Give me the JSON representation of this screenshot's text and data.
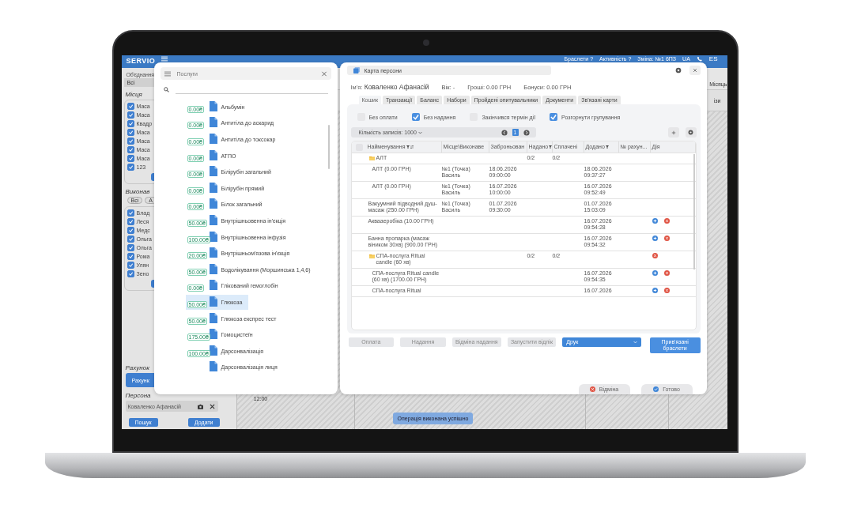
{
  "top_bar": {
    "logo": "SERVIO",
    "items": [
      "Браслети ?",
      "Активність ?",
      "Зміна: №1 6ПЗ",
      "UA"
    ],
    "language": "ES"
  },
  "sidebar": {
    "union_label": "Об'єднання",
    "union_value": "Всі",
    "places_title": "Місця",
    "places": [
      {
        "label": "Маса",
        "checked": true
      },
      {
        "label": "Маса",
        "checked": true
      },
      {
        "label": "Квадр",
        "checked": true
      },
      {
        "label": "Маса",
        "checked": true
      },
      {
        "label": "Маса",
        "checked": true
      },
      {
        "label": "Маса",
        "checked": true
      },
      {
        "label": "Маса",
        "checked": true
      },
      {
        "label": "123",
        "checked": true
      }
    ],
    "executors_title": "Виконав",
    "executor_filters": [
      "Всі",
      "А"
    ],
    "executors": [
      {
        "label": "Влад",
        "checked": true
      },
      {
        "label": "Леся",
        "checked": true
      },
      {
        "label": "Медс",
        "checked": true
      },
      {
        "label": "Ольга",
        "checked": true
      },
      {
        "label": "Ольга",
        "checked": true
      },
      {
        "label": "Рома",
        "checked": true
      },
      {
        "label": "Улян",
        "checked": true
      },
      {
        "label": "Зено",
        "checked": true
      }
    ],
    "account_title": "Рахунок",
    "account_button": "Рахунк",
    "person_title": "Персона",
    "person_value": "Коваленко Афанасій",
    "buttons": [
      "Пошук",
      "Додати"
    ]
  },
  "calendar": {
    "view": "Місяць",
    "column_header": "ізи",
    "time": "12:00"
  },
  "services": {
    "title": "Послуги",
    "items": [
      {
        "name": "Альбумін",
        "price": "0.00₴",
        "selected": false
      },
      {
        "name": "Антитіла до аскарид",
        "price": "0.00₴",
        "selected": false
      },
      {
        "name": "Антитіла до токсокар",
        "price": "0.00₴",
        "selected": false
      },
      {
        "name": "АТПО",
        "price": "0.00₴",
        "selected": false
      },
      {
        "name": "Білірубін загальний",
        "price": "0.00₴",
        "selected": false
      },
      {
        "name": "Білірубін прямий",
        "price": "0.00₴",
        "selected": false
      },
      {
        "name": "Білок загальний",
        "price": "0.00₴",
        "selected": false
      },
      {
        "name": "Внутрішньовенна ін'єкція",
        "price": "50.00₴",
        "selected": false
      },
      {
        "name": "Внутрішньовенна інфузія",
        "price": "100.00₴",
        "selected": false
      },
      {
        "name": "Внутрішньом'язова ін'єкція",
        "price": "20.00₴",
        "selected": false
      },
      {
        "name": "Водолікування (Моршинська 1,4,6)",
        "price": "50.00₴",
        "selected": false
      },
      {
        "name": "Глікований гемоглобін",
        "price": "0.00₴",
        "selected": false
      },
      {
        "name": "Глюкоза",
        "price": "50.00₴",
        "selected": true
      },
      {
        "name": "Глюкоза експрес тест",
        "price": "50.00₴",
        "selected": false
      },
      {
        "name": "Гомоцистеїн",
        "price": "175.00₴",
        "selected": false
      },
      {
        "name": "Дарсонвалізація",
        "price": "100.00₴",
        "selected": false
      },
      {
        "name": "Дарсонвалізація лиця",
        "selected": false
      }
    ]
  },
  "person_card": {
    "title": "Карта персони",
    "name_label": "Ім'я:",
    "name": "Коваленко Афанасій",
    "age": "Вік: -",
    "money": "Гроші: 0.00 ГРН",
    "bonuses": "Бонуси: 0.00 ГРН",
    "tabs": [
      {
        "label": "Кошик",
        "selected": true
      },
      {
        "label": "Транзакції",
        "selected": false
      },
      {
        "label": "Баланс",
        "selected": false
      },
      {
        "label": "Набори",
        "selected": false
      },
      {
        "label": "Пройдені опитувальники",
        "selected": false
      },
      {
        "label": "Документи",
        "selected": false
      },
      {
        "label": "Зв'язані карти",
        "selected": false
      }
    ],
    "filters": [
      {
        "label": "Без оплати",
        "checked": false
      },
      {
        "label": "Без надання",
        "checked": true
      },
      {
        "label": "Закінчився термін дії",
        "checked": false
      },
      {
        "label": "Розгорнути групування",
        "checked": true
      }
    ],
    "records_label": "Кількість записів: 1000",
    "page": "1",
    "select_all_checked": false,
    "columns": [
      {
        "label": "Найменування",
        "filter": true,
        "sort": true
      },
      {
        "label": "Місце\\Виконаве",
        "filter": false,
        "sort": false
      },
      {
        "label": "Заброньован",
        "filter": false,
        "sort": false
      },
      {
        "label": "Надано",
        "filter": true,
        "sort": false
      },
      {
        "label": "Сплачені",
        "filter": false,
        "sort": false
      },
      {
        "label": "Додано",
        "filter": true,
        "sort": false
      },
      {
        "label": "№ рахун...",
        "filter": false,
        "sort": false
      },
      {
        "label": "Дія",
        "filter": false,
        "sort": false
      }
    ],
    "rows": [
      {
        "name": "АЛТ",
        "provided": "0/2",
        "paid": "0/2",
        "can_add": false,
        "can_remove": false,
        "children": [
          {
            "name": "АЛТ (0.00 ГРН)",
            "place": "№1 (Точка) Василь",
            "booked": "18.06.2026 09:00:00",
            "added": "18.06.2026 09:37:27",
            "can_add": false,
            "can_remove": false
          },
          {
            "name": "АЛТ (0.00 ГРН)",
            "place": "№1 (Точка) Василь",
            "booked": "16.07.2026 10:00:00",
            "added": "16.07.2026 09:52:49",
            "can_add": false,
            "can_remove": false
          }
        ]
      },
      {
        "name": "Вакуумний підводний душ-масаж (250.00 ГРН)",
        "place": "№1 (Точка) Василь",
        "booked": "01.07.2026 09:30:00",
        "added": "01.07.2026 15:03:09",
        "can_add": false,
        "can_remove": false
      },
      {
        "name": "Аквааеробіка (10.00 ГРН)",
        "added": "16.07.2026 09:54:28",
        "can_add": true,
        "can_remove": true
      },
      {
        "name": "Банна пропарка (масаж віником 30хв) (900.00 ГРН)",
        "added": "16.07.2026 09:54:32",
        "can_add": true,
        "can_remove": true
      },
      {
        "name": "СПА-послуга Ritual candle (60 хв)",
        "provided": "0/2",
        "paid": "0/2",
        "can_add": false,
        "can_remove": true,
        "children": [
          {
            "name": "СПА-послуга Ritual candle (60 хв) (1700.00 ГРН)",
            "added": "16.07.2026 09:54:35",
            "can_add": true,
            "can_remove": true
          },
          {
            "name": "СПА-послуга Ritual",
            "added": "16.07.2026",
            "can_add": true,
            "can_remove": true
          }
        ]
      }
    ],
    "actions": [
      {
        "label": "Оплата",
        "kind": "plain"
      },
      {
        "label": "Надання",
        "kind": "plain"
      },
      {
        "label": "Відміна надання",
        "kind": "plain"
      },
      {
        "label": "Запустити відлік",
        "kind": "plain"
      },
      {
        "label": "Друк",
        "kind": "dropdown"
      },
      {
        "label": "Прив'язані браслети",
        "kind": "primary"
      }
    ],
    "footer": [
      {
        "label": "Відміна",
        "kind": "cancel"
      },
      {
        "label": "Готово",
        "kind": "done"
      }
    ]
  },
  "toast": "Операція виконана успішно"
}
